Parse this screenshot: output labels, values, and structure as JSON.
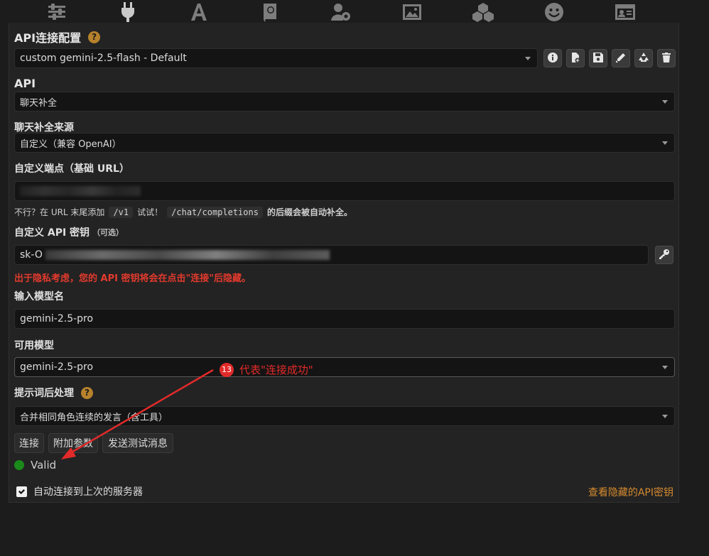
{
  "topbar": {
    "icons": [
      "sliders-icon",
      "plug-icon",
      "font-icon",
      "book-icon",
      "user-gear-icon",
      "image-icon",
      "cubes-icon",
      "smiley-icon",
      "id-card-icon"
    ]
  },
  "api_connection": {
    "title": "API连接配置",
    "help": "?",
    "profile": "custom gemini-2.5-flash - Default"
  },
  "api": {
    "label": "API",
    "value": "聊天补全"
  },
  "source": {
    "label": "聊天补全来源",
    "value": "自定义（兼容 OpenAI）"
  },
  "endpoint": {
    "label": "自定义端点（基础 URL）",
    "hint_prefix": "不行？在 URL 末尾添加",
    "hint_code1": "/v1",
    "hint_mid": "试试！",
    "hint_code2": "/chat/completions",
    "hint_suffix": "的后缀会被自动补全。"
  },
  "api_key": {
    "label": "自定义 API 密钥",
    "optional": "（可选）",
    "value_prefix": "sk-O",
    "warning": "出于隐私考虑，您的 API 密钥将会在点击\"连接\"后隐藏。"
  },
  "model_name": {
    "label": "输入模型名",
    "value": "gemini-2.5-pro"
  },
  "available_models": {
    "label": "可用模型",
    "value": "gemini-2.5-pro"
  },
  "post_processing": {
    "label": "提示词后处理",
    "help": "?",
    "value": "合并相同角色连续的发言（含工具）"
  },
  "buttons": {
    "connect": "连接",
    "extra_params": "附加参数",
    "send_test": "发送测试消息"
  },
  "status": {
    "text": "Valid",
    "color": "#1a8a1a"
  },
  "auto_connect": {
    "label": "自动连接到上次的服务器",
    "checked": true
  },
  "view_hidden_keys": "查看隐藏的API密钥",
  "annotation": {
    "number": "13",
    "text": "代表\"连接成功\"",
    "color": "#e22a2a"
  }
}
